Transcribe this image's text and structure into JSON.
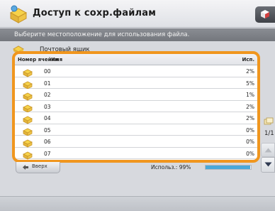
{
  "window": {
    "title": "Доступ к сохр.файлам"
  },
  "instruction": "Выберите местоположение для использования файла.",
  "location": {
    "label": "Почтовый ящик"
  },
  "table": {
    "headers": {
      "box_number": "Номер ячейки",
      "name": "Имя",
      "used": "Исп."
    },
    "rows": [
      {
        "number": "00",
        "name": "",
        "used": "2%"
      },
      {
        "number": "01",
        "name": "",
        "used": "5%"
      },
      {
        "number": "02",
        "name": "",
        "used": "1%"
      },
      {
        "number": "03",
        "name": "",
        "used": "2%"
      },
      {
        "number": "04",
        "name": "",
        "used": "2%"
      },
      {
        "number": "05",
        "name": "",
        "used": "0%"
      },
      {
        "number": "06",
        "name": "",
        "used": "0%"
      },
      {
        "number": "07",
        "name": "",
        "used": "0%"
      }
    ]
  },
  "footer": {
    "back_label": "Вверх",
    "usage_label": "Использ.: 99%",
    "usage_fraction": 0.99
  },
  "pager": {
    "page": "1/1"
  },
  "colors": {
    "highlight": "#f0961e",
    "usage_fill": "#4aa8d8",
    "instruction_bar": "#7f8288"
  },
  "icons": {
    "title": "mailbox-folder-icon",
    "row": "mailbox-box-icon",
    "corner": "function-menu-icon"
  }
}
